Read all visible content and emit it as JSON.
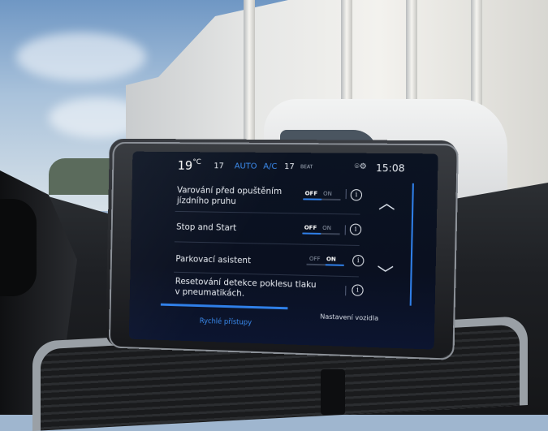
{
  "climate": {
    "temp_left": "19",
    "temp_unit": "°C",
    "fan_level": "17",
    "auto_label": "AUTO",
    "ac_label": "A/C",
    "temp_right": "17",
    "audio_label": "BEAT"
  },
  "clock": "15:08",
  "settings": [
    {
      "label": "Varování před opuštěním jízdního pruhu",
      "off": "OFF",
      "on": "ON",
      "state": "OFF"
    },
    {
      "label": "Stop and Start",
      "off": "OFF",
      "on": "ON",
      "state": "OFF"
    },
    {
      "label": "Parkovací asistent",
      "off": "OFF",
      "on": "ON",
      "state": "ON"
    },
    {
      "label": "Resetování detekce poklesu tlaku v pneumatikách.",
      "state": null
    }
  ],
  "nav": {
    "up_icon": "chevron-up-icon",
    "down_icon": "chevron-down-icon"
  },
  "tabs": {
    "left": "Rychlé přístupy",
    "right": "Nastavení vozidla"
  },
  "colors": {
    "accent": "#2f7fe8",
    "screen_bg": "#0b1322"
  }
}
